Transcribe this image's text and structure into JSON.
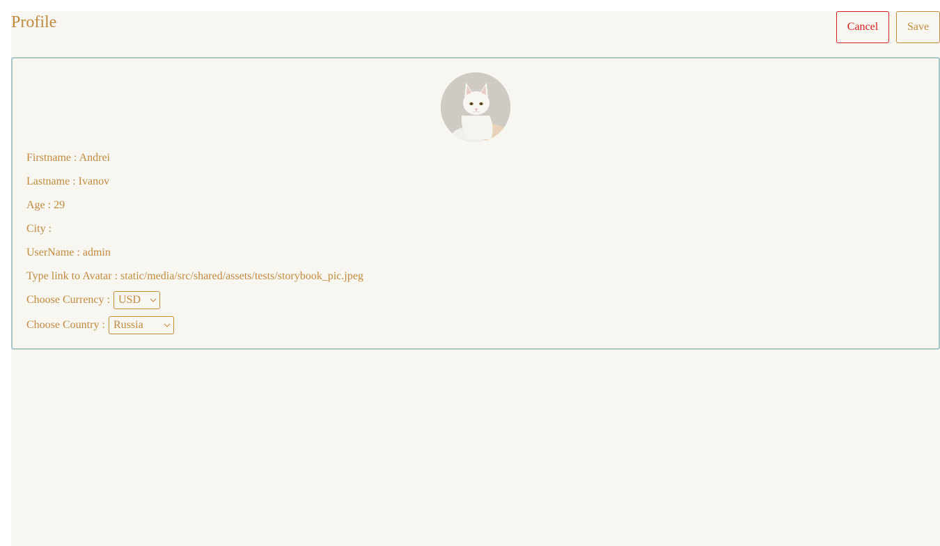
{
  "header": {
    "title": "Profile",
    "cancel_label": "Cancel",
    "save_label": "Save"
  },
  "profile": {
    "firstname": {
      "label": "Firstname :",
      "value": "Andrei"
    },
    "lastname": {
      "label": "Lastname :",
      "value": "Ivanov"
    },
    "age": {
      "label": "Age :",
      "value": "29"
    },
    "city": {
      "label": "City :",
      "value": ""
    },
    "username": {
      "label": "UserName :",
      "value": "admin"
    },
    "avatar_link": {
      "label": "Type link to Avatar :",
      "value": "static/media/src/shared/assets/tests/storybook_pic.jpeg"
    },
    "currency": {
      "label": "Choose Currency :",
      "selected": "USD"
    },
    "country": {
      "label": "Choose Country :",
      "selected": "Russia"
    }
  },
  "icons": {
    "avatar": "cat-avatar-image",
    "select_chevron": "chevron-down-icon"
  },
  "colors": {
    "accent": "#c08a3e",
    "danger": "#d51e1e",
    "card_border": "#a7c7c7",
    "background": "#f8f6f1"
  }
}
